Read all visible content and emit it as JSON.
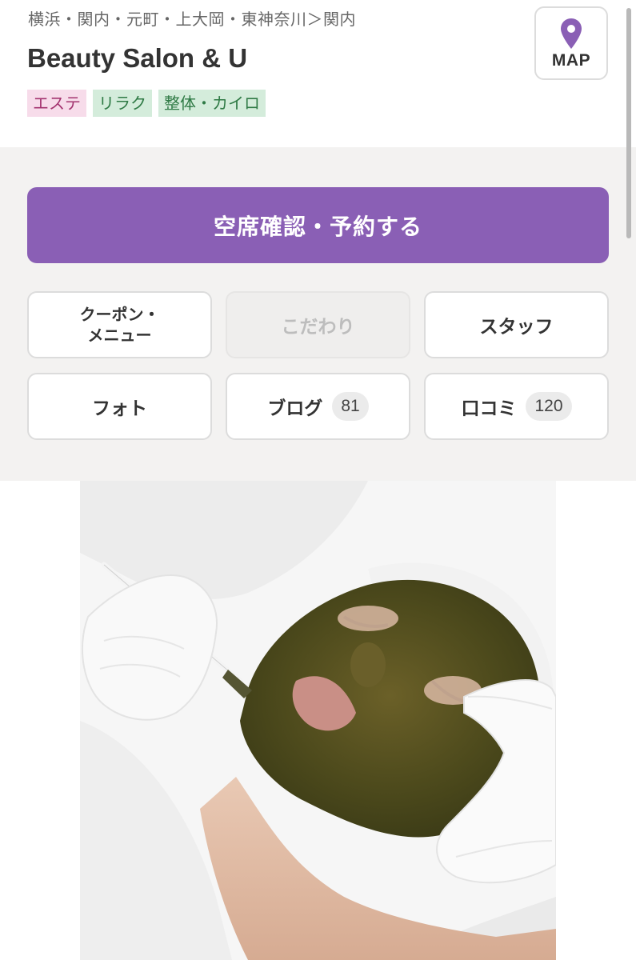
{
  "header": {
    "breadcrumb": "横浜・関内・元町・上大岡・東神奈川＞関内",
    "salon_name": "Beauty Salon & U",
    "tags": [
      {
        "label": "エステ",
        "color": "#f7dcea"
      },
      {
        "label": "リラク",
        "color": "#d4ecdb"
      },
      {
        "label": "整体・カイロ",
        "color": "#d4ecdb"
      }
    ],
    "map_button": {
      "label": "MAP",
      "icon": "map-pin-icon",
      "color": "#8a5fb5"
    }
  },
  "actions": {
    "reserve_label": "空席確認・予約する",
    "reserve_color": "#8a5fb5",
    "nav": {
      "coupon_line1": "クーポン・",
      "coupon_line2": "メニュー",
      "kodawari": "こだわり",
      "staff": "スタッフ",
      "photo": "フォト",
      "blog": "ブログ",
      "blog_count": "81",
      "reviews": "口コミ",
      "reviews_count": "120"
    }
  },
  "photo": {
    "subject": "facial-mask-treatment-image"
  }
}
